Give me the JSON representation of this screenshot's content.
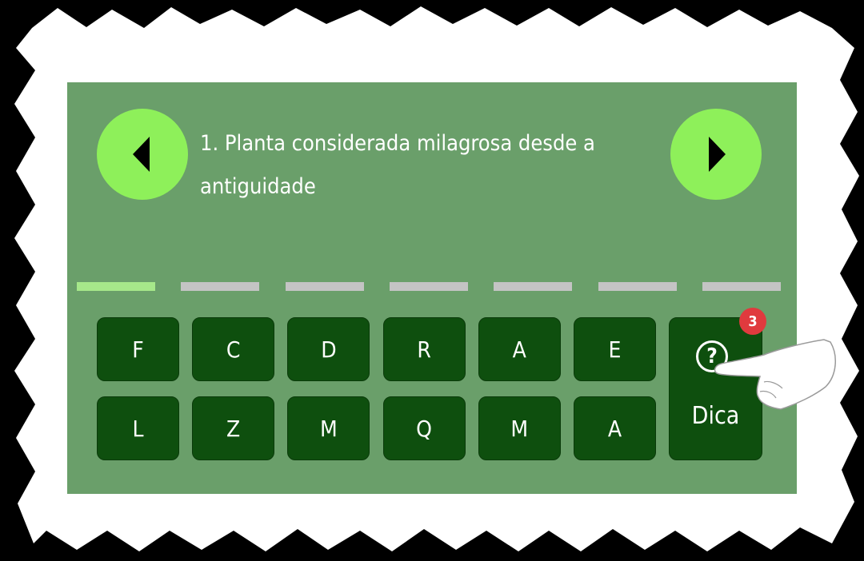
{
  "game": {
    "clue": "1. Planta considerada milagrosa desde a antiguidade",
    "answer_slots": [
      {
        "state": "active"
      },
      {
        "state": "empty"
      },
      {
        "state": "empty"
      },
      {
        "state": "empty"
      },
      {
        "state": "empty"
      },
      {
        "state": "empty"
      },
      {
        "state": "empty"
      }
    ],
    "keyboard": {
      "row1": [
        "F",
        "C",
        "D",
        "R",
        "A",
        "E"
      ],
      "row2": [
        "L",
        "Z",
        "M",
        "Q",
        "M",
        "A"
      ]
    },
    "hint": {
      "icon": "question-circle-icon",
      "label": "Dica",
      "remaining": "3"
    },
    "nav": {
      "prev_icon": "triangle-left-icon",
      "next_icon": "triangle-right-icon"
    }
  },
  "colors": {
    "panel": "#6a9f6a",
    "nav_button": "#8ef05a",
    "key": "#0e4f0e",
    "slot_active": "#a6e88a",
    "slot_empty": "#c4c4c4",
    "badge": "#e03a3e"
  }
}
